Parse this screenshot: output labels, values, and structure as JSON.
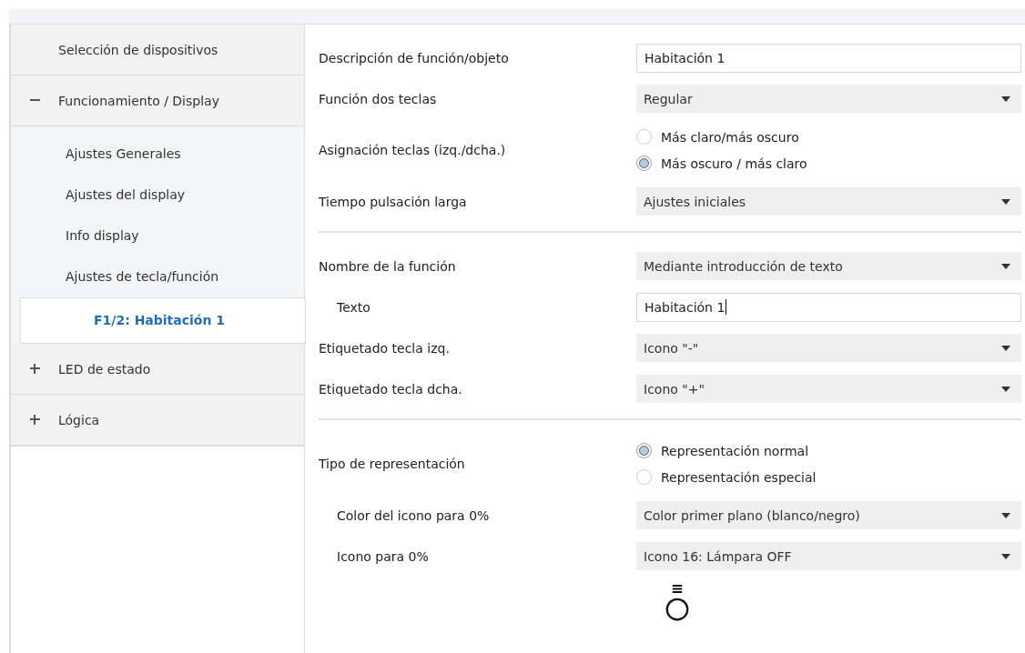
{
  "sidebar": {
    "items": [
      {
        "label": "Selección de dispositivos",
        "kind": "plain"
      },
      {
        "label": "Funcionamiento / Display",
        "kind": "group",
        "expanded": true,
        "children": [
          {
            "label": "Ajustes Generales",
            "selected": false
          },
          {
            "label": "Ajustes del display",
            "selected": false
          },
          {
            "label": "Info display",
            "selected": false
          },
          {
            "label": "Ajustes de tecla/función",
            "selected": false,
            "children": [
              {
                "label": "F1/2: Habitación 1",
                "selected": true
              }
            ]
          }
        ]
      },
      {
        "label": "LED de estado",
        "kind": "group",
        "expanded": false
      },
      {
        "label": "Lógica",
        "kind": "group",
        "expanded": false
      }
    ]
  },
  "sections": [
    {
      "rows": [
        {
          "label": "Descripción de función/objeto",
          "kind": "text",
          "indented": false,
          "value": "Habitación 1",
          "focused": false
        },
        {
          "label": "Función dos teclas",
          "kind": "select",
          "indented": false,
          "value": "Regular"
        },
        {
          "label": "Asignación teclas (izq./dcha.)",
          "kind": "radio",
          "indented": false,
          "options": [
            {
              "label": "Más claro/más oscuro",
              "selected": false
            },
            {
              "label": "Más oscuro / más claro",
              "selected": true
            }
          ]
        },
        {
          "label": "Tiempo pulsación larga",
          "kind": "select",
          "indented": false,
          "value": "Ajustes iniciales"
        }
      ]
    },
    {
      "rows": [
        {
          "label": "Nombre de la función",
          "kind": "select",
          "indented": false,
          "value": "Mediante introducción de texto"
        },
        {
          "label": "Texto",
          "kind": "text",
          "indented": true,
          "value": "Habitación 1",
          "focused": true
        },
        {
          "label": "Etiquetado tecla izq.",
          "kind": "select",
          "indented": false,
          "value": "Icono \"-\""
        },
        {
          "label": "Etiquetado tecla dcha.",
          "kind": "select",
          "indented": false,
          "value": "Icono \"+\""
        }
      ]
    },
    {
      "rows": [
        {
          "label": "Tipo de representación",
          "kind": "radio",
          "indented": false,
          "options": [
            {
              "label": "Representación normal",
              "selected": true
            },
            {
              "label": "Representación especial",
              "selected": false
            }
          ]
        },
        {
          "label": "Color del icono para 0%",
          "kind": "select",
          "indented": true,
          "value": "Color primer plano (blanco/negro)"
        },
        {
          "label": "Icono para 0%",
          "kind": "select",
          "indented": true,
          "value": "Icono 16: Lámpara OFF"
        },
        {
          "kind": "preview"
        }
      ]
    }
  ]
}
